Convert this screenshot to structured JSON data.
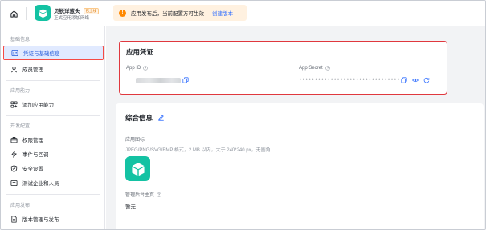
{
  "topbar": {
    "app_name": "贝锐洋葱头",
    "app_badge": "已上线",
    "app_desc": "正式应用添加网络",
    "notice_text": "应用发布后，当前配置方可生效",
    "notice_link": "创建版本",
    "colors": {
      "app_icon": "#14c2a3",
      "notice_bg": "#fff1e0",
      "notice_icon": "#ff8800",
      "link": "#3370ff"
    }
  },
  "sidebar": {
    "groups": [
      {
        "title": "基础信息",
        "items": [
          {
            "label": "凭证与基础信息",
            "icon": "id-card-icon",
            "active": true
          },
          {
            "label": "成员管理",
            "icon": "person-icon"
          }
        ]
      },
      {
        "title": "应用能力",
        "items": [
          {
            "label": "添加应用能力",
            "icon": "grid-add-icon"
          }
        ]
      },
      {
        "title": "开发配置",
        "items": [
          {
            "label": "权限管理",
            "icon": "briefcase-icon"
          },
          {
            "label": "事件与回调",
            "icon": "lightning-icon"
          },
          {
            "label": "安全设置",
            "icon": "shield-icon"
          },
          {
            "label": "测试企业和人员",
            "icon": "test-tube-icon"
          }
        ]
      },
      {
        "title": "应用发布",
        "items": [
          {
            "label": "版本管理与发布",
            "icon": "document-icon"
          }
        ]
      }
    ]
  },
  "credentials": {
    "title": "应用凭证",
    "app_id_label": "App ID",
    "app_secret_label": "App Secret",
    "app_secret_value": "••••••••••••••••••••••••••••••••"
  },
  "info": {
    "title": "综合信息",
    "icon_label": "应用图标",
    "icon_hint": "JPEG/PNG/SVG/BMP 格式，2 MB 以内，大于 240*240 px，无圆角",
    "homepage_label": "管理后台主页",
    "homepage_value": "暂无"
  }
}
